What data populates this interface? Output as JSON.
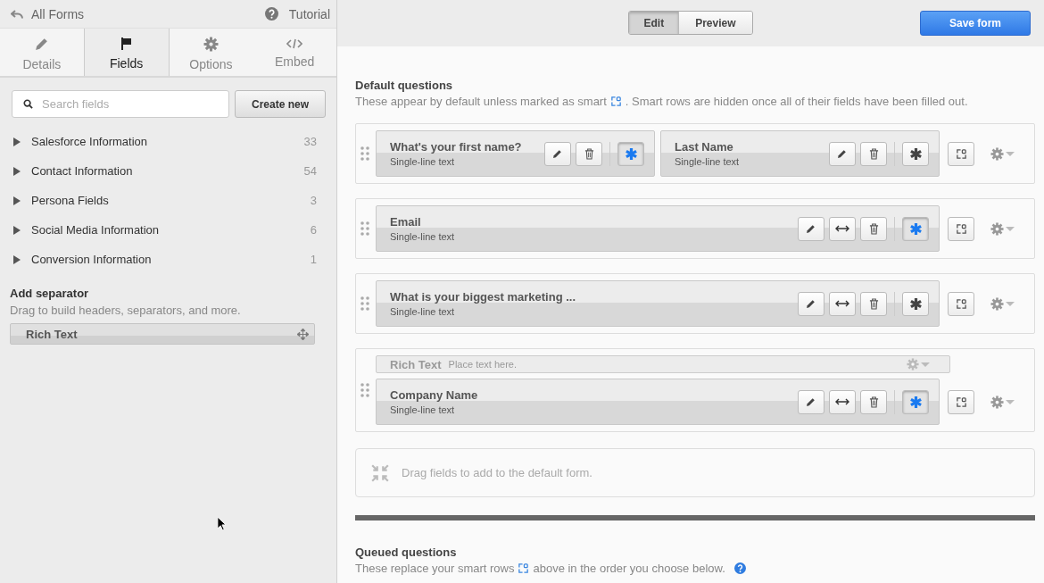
{
  "sidebar": {
    "back_link": "All Forms",
    "tutorial_link": "Tutorial",
    "tabs": [
      {
        "label": "Details",
        "selected": false
      },
      {
        "label": "Fields",
        "selected": true
      },
      {
        "label": "Options",
        "selected": false
      },
      {
        "label": "Embed",
        "selected": false
      }
    ],
    "search": {
      "placeholder": "Search fields"
    },
    "create_button": "Create new",
    "groups": [
      {
        "label": "Salesforce Information",
        "count": "33"
      },
      {
        "label": "Contact Information",
        "count": "54"
      },
      {
        "label": "Persona Fields",
        "count": "3"
      },
      {
        "label": "Social Media Information",
        "count": "6"
      },
      {
        "label": "Conversion Information",
        "count": "1"
      }
    ],
    "separator_heading": "Add separator",
    "separator_hint": "Drag to build headers, separators, and more.",
    "separator_item": "Rich Text"
  },
  "toolbar": {
    "modes": [
      {
        "label": "Edit",
        "selected": true
      },
      {
        "label": "Preview",
        "selected": false
      }
    ],
    "save_button": "Save form"
  },
  "default_section": {
    "heading": "Default questions",
    "text_before": "These appear by default unless marked as smart",
    "text_after": ". Smart rows are hidden once all of their fields have been filled out.",
    "rows": [
      {
        "fields": [
          {
            "label": "What's your first name?",
            "type": "Single-line text",
            "required": true,
            "width_toggle": false
          },
          {
            "label": "Last Name",
            "type": "Single-line text",
            "required": false,
            "width_toggle": false
          }
        ]
      },
      {
        "fields": [
          {
            "label": "Email",
            "type": "Single-line text",
            "required": true,
            "width_toggle": true
          }
        ]
      },
      {
        "fields": [
          {
            "label": "What is your biggest marketing ...",
            "type": "Single-line text",
            "required": false,
            "width_toggle": true
          }
        ]
      },
      {
        "separator": {
          "label": "Rich Text",
          "placeholder": "Place text here."
        },
        "fields": [
          {
            "label": "Company Name",
            "type": "Single-line text",
            "required": true,
            "width_toggle": true
          }
        ]
      }
    ],
    "drop_hint": "Drag fields to add to the default form."
  },
  "queued_section": {
    "heading": "Queued questions",
    "text_before": "These replace your smart rows",
    "text_after": "above in the order you choose below."
  }
}
